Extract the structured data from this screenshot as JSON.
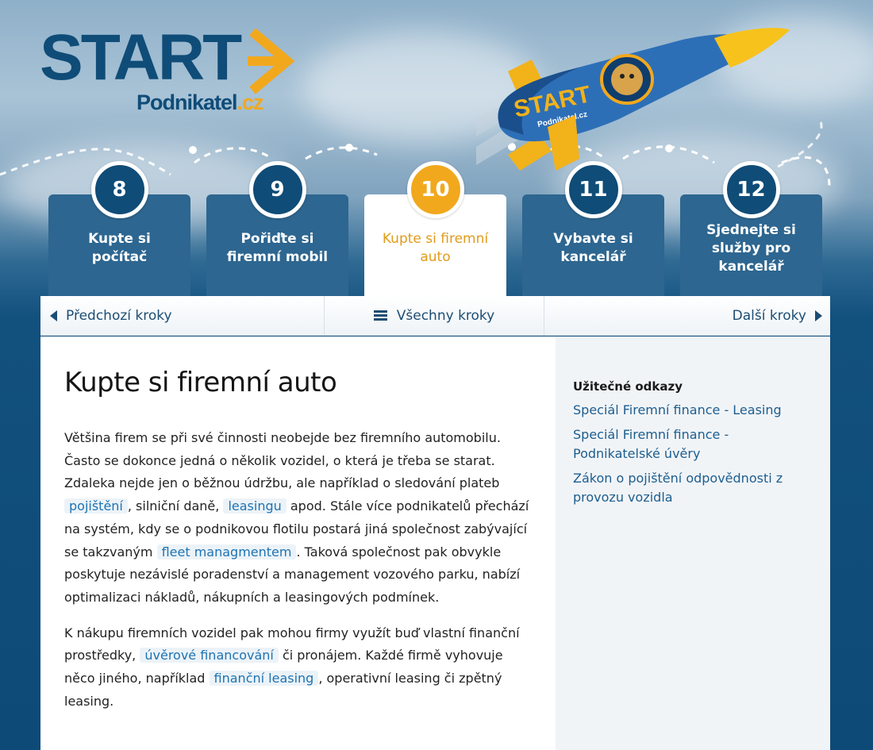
{
  "logo": {
    "start": "START",
    "sub_main": "Podnikatel",
    "sub_tld": ".cz",
    "rocket_label": "START",
    "rocket_sub": "Podnikatel.cz"
  },
  "colors": {
    "navy": "#0f4c78",
    "accent": "#f2a81d",
    "tab": "#2d6690",
    "link": "#1e73b2"
  },
  "steps": [
    {
      "number": "8",
      "label": "Kupte si počítač"
    },
    {
      "number": "9",
      "label": "Pořiďte si firemní mobil"
    },
    {
      "number": "10",
      "label": "Kupte si firemní auto",
      "active": true
    },
    {
      "number": "11",
      "label": "Vybavte si kancelář"
    },
    {
      "number": "12",
      "label": "Sjednejte si služby pro kancelář"
    }
  ],
  "nav": {
    "prev": "Předchozí kroky",
    "all": "Všechny kroky",
    "next": "Další kroky",
    "icons": [
      "triangle-left-icon",
      "menu-icon",
      "triangle-right-icon"
    ]
  },
  "article": {
    "title": "Kupte si firemní auto",
    "p1": {
      "t1": "Většina firem se při své činnosti neobejde bez firemního automobilu. Často se dokonce jedná o několik vozidel, o která je třeba se starat. Zdaleka nejde jen o běžnou údržbu, ale například o sledování plateb",
      "l1": "pojištění",
      "t2": ", silniční daně,",
      "l2": "leasingu",
      "t3": "apod. Stále více podnikatelů přechází na systém, kdy se o podnikovou flotilu postará jiná společnost zabývající se takzvaným",
      "l3": "fleet managmentem",
      "t4": ". Taková společnost pak obvykle poskytuje nezávislé poradenství a management vozového parku, nabízí optimalizaci nákladů, nákupních a leasingových podmínek."
    },
    "p2": {
      "t1": "K nákupu firemních vozidel pak mohou firmy využít buď vlastní finanční prostředky,",
      "l1": "úvěrové financování",
      "t2": "či pronájem. Každé firmě vyhovuje něco jiného, například",
      "l2": "finanční leasing",
      "t3": ", operativní leasing či zpětný leasing."
    }
  },
  "sidebar": {
    "heading": "Užitečné odkazy",
    "links": [
      "Speciál Firemní finance - Leasing",
      "Speciál Firemní finance - Podnikatelské úvěry",
      "Zákon o pojištění odpovědnosti z provozu vozidla"
    ]
  }
}
